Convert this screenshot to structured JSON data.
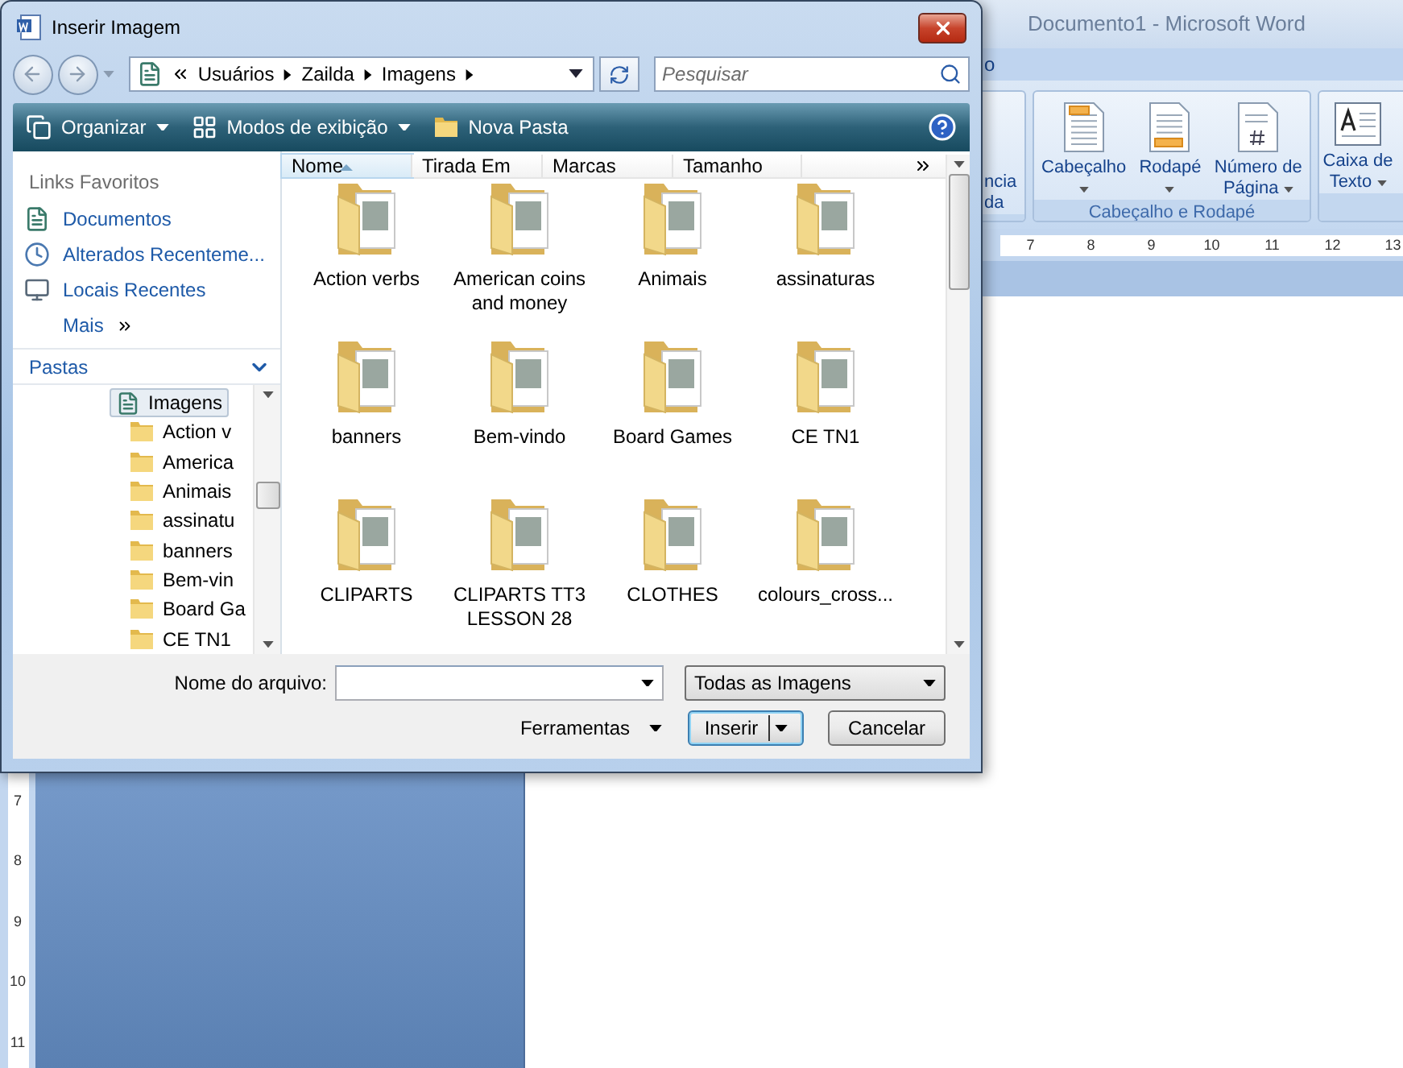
{
  "word": {
    "title": "Documento1 - Microsoft Word",
    "tab_partial": "o",
    "ribbon": {
      "partial_label": "ncia da",
      "groups": [
        {
          "label": "Cabeçalho e Rodapé",
          "buttons": [
            {
              "label": "Cabeçalho",
              "kind": "header"
            },
            {
              "label": "Rodapé",
              "kind": "footer"
            },
            {
              "label": "Número de Página",
              "kind": "page-number"
            }
          ]
        },
        {
          "buttons": [
            {
              "label": "Caixa de Texto",
              "kind": "textbox"
            }
          ]
        }
      ]
    },
    "ruler": [
      "7",
      "8",
      "9",
      "10",
      "11",
      "12",
      "13"
    ],
    "vertical_ruler": [
      "7",
      "8",
      "9",
      "10",
      "11"
    ]
  },
  "dialog": {
    "title": "Inserir Imagem",
    "breadcrumb": [
      "Usuários",
      "Zailda",
      "Imagens"
    ],
    "search": {
      "placeholder": "Pesquisar"
    },
    "toolbar": [
      {
        "label": "Organizar",
        "kind": "organize",
        "dropdown": true
      },
      {
        "label": "Modos de exibição",
        "kind": "views",
        "dropdown": true
      },
      {
        "label": "Nova Pasta",
        "kind": "new-folder",
        "dropdown": false
      }
    ],
    "favorites": {
      "title": "Links Favoritos",
      "items": [
        {
          "label": "Documentos",
          "kind": "documents"
        },
        {
          "label": "Alterados Recenteme...",
          "kind": "recent-changed"
        },
        {
          "label": "Locais Recentes",
          "kind": "recent-places"
        },
        {
          "label": "Mais",
          "kind": "more"
        }
      ]
    },
    "folders": {
      "title": "Pastas",
      "expanded": true,
      "tree": [
        {
          "label": "Imagens",
          "selected": true,
          "children": [
            {
              "label": "Action v",
              "selected": false
            },
            {
              "label": "America",
              "selected": false
            },
            {
              "label": "Animais",
              "selected": false
            },
            {
              "label": "assinatu",
              "selected": false
            },
            {
              "label": "banners",
              "selected": false
            },
            {
              "label": "Bem-vin",
              "selected": false
            },
            {
              "label": "Board Ga",
              "selected": false
            },
            {
              "label": "CE TN1",
              "selected": false
            }
          ]
        }
      ]
    },
    "columns": [
      {
        "label": "Nome",
        "sorted": true
      },
      {
        "label": "Tirada Em",
        "sorted": false
      },
      {
        "label": "Marcas",
        "sorted": false
      },
      {
        "label": "Tamanho",
        "sorted": false
      }
    ],
    "files": [
      {
        "name": "Action verbs"
      },
      {
        "name": "American coins and money"
      },
      {
        "name": "Animais"
      },
      {
        "name": "assinaturas"
      },
      {
        "name": "banners"
      },
      {
        "name": "Bem-vindo"
      },
      {
        "name": "Board Games"
      },
      {
        "name": "CE TN1"
      },
      {
        "name": "CLIPARTS"
      },
      {
        "name": "CLIPARTS TT3 LESSON 28"
      },
      {
        "name": "CLOTHES"
      },
      {
        "name": "colours_cross..."
      }
    ],
    "file_name": {
      "label": "Nome do arquivo:"
    },
    "filter": "Todas as Imagens",
    "tools": "Ferramentas",
    "buttons": [
      {
        "label": "Inserir",
        "kind": "split",
        "default": true
      },
      {
        "label": "Cancelar",
        "kind": "plain",
        "default": false
      }
    ]
  }
}
